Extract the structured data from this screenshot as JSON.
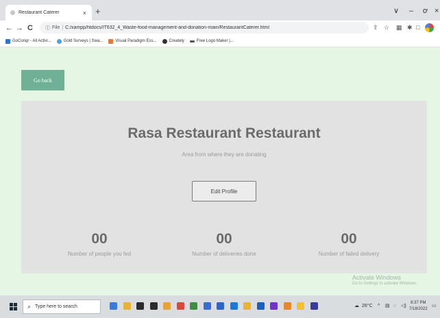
{
  "browser": {
    "tab_title": "Restaurant Caterer",
    "tab_close_glyph": "×",
    "new_tab_glyph": "+",
    "window_controls": [
      "∨",
      "–",
      "ơ",
      "×"
    ],
    "nav": {
      "back_glyph": "←",
      "forward_glyph": "→",
      "reload_glyph": "C"
    },
    "address": {
      "info_glyph": "ⓘ",
      "scheme_label": "File",
      "url": "C:/xampp/htdocs/IT632_4_Waste-food-management-and-donation-main/RestaurantCaterer.html"
    },
    "toolbar_icons": [
      "share-icon",
      "star-icon",
      "extension-icon",
      "puzzle-icon",
      "sidebar-icon",
      "profile-icon"
    ],
    "bookmarks": [
      {
        "label": "GoConqr - All Activi...",
        "color": "#2c77d1",
        "icon": "goconqr-icon"
      },
      {
        "label": "Gold Surveys | Swa...",
        "color": "#4aa3df",
        "icon": "gold-surveys-icon"
      },
      {
        "label": "Visual Paradigm Ess...",
        "color": "#e8773a",
        "icon": "visual-paradigm-icon"
      },
      {
        "label": "Creately",
        "color": "#333333",
        "icon": "creately-icon"
      },
      {
        "label": "Free Logo Maker |...",
        "color": "#555555",
        "icon": "logo-maker-icon"
      }
    ]
  },
  "page": {
    "go_back_label": "Go back",
    "restaurant_name": "Rasa Restaurant Restaurant",
    "area_text": "Area from where they are donating",
    "edit_profile_label": "Edit Profile",
    "stats": [
      {
        "value": "00",
        "label": "Number of people you fed"
      },
      {
        "value": "00",
        "label": "Number of deliveries done"
      },
      {
        "value": "00",
        "label": "Number of failed delivery"
      }
    ],
    "watermark_title": "Activate Windows",
    "watermark_sub": "Go to Settings to activate Windows."
  },
  "taskbar": {
    "search_placeholder": "Type here to search",
    "weather": "26°C",
    "time": "8:37 PM",
    "date": "7/18/2022",
    "pinned_colors": [
      "#3b7bd4",
      "#e4b43a",
      "#2b2b2b",
      "#2b2b2b",
      "#e8a23a",
      "#d24d3f",
      "#3e8e41",
      "#3c6bd6",
      "#2f64c8",
      "#1f78d1",
      "#e9b531",
      "#1d5fbf",
      "#6e36c2",
      "#e6892e",
      "#f2c230",
      "#3a3a9a"
    ],
    "colors": {
      "accent": "#70b096",
      "page_bg": "#e5f6e5",
      "card_bg": "#e2e2e2"
    }
  }
}
